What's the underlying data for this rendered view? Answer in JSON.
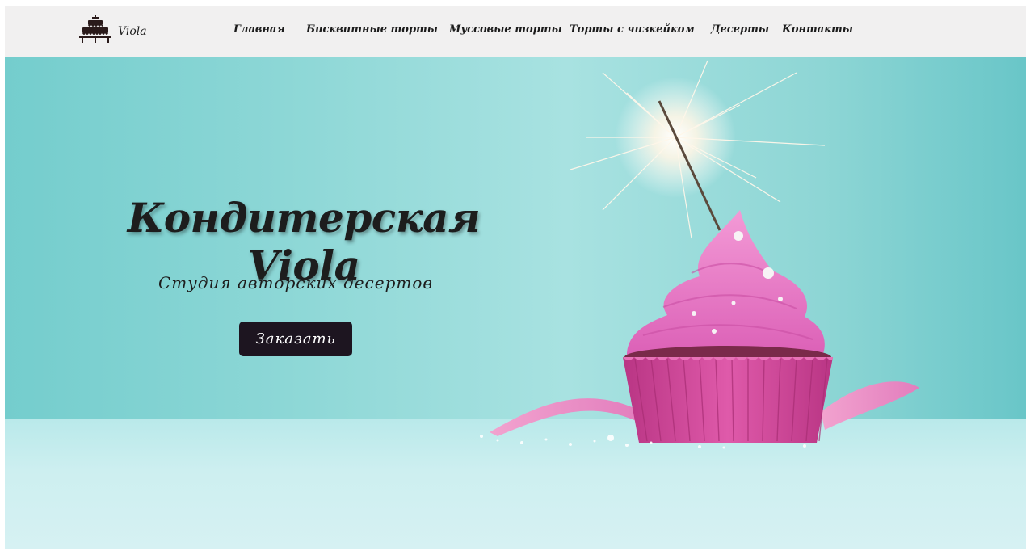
{
  "header": {
    "brand": {
      "logo_icon": "cake-logo-icon",
      "text": "Viola"
    },
    "nav": [
      {
        "label": "Главная"
      },
      {
        "label": "Бисквитные торты"
      },
      {
        "label": "Муссовые торты"
      },
      {
        "label": "Торты с чизкейком"
      },
      {
        "label": "Десерты"
      },
      {
        "label": "Контакты"
      }
    ]
  },
  "hero": {
    "title": "Кондитерская Viola",
    "subtitle": "Студия авторских десертов",
    "order_button": "Заказать",
    "image_subject": "pink cupcake with sparkler",
    "colors": {
      "background": "#8fd8d7",
      "button": "#1d1520",
      "frosting": "#e774c2",
      "wrapper": "#d4499e"
    }
  }
}
